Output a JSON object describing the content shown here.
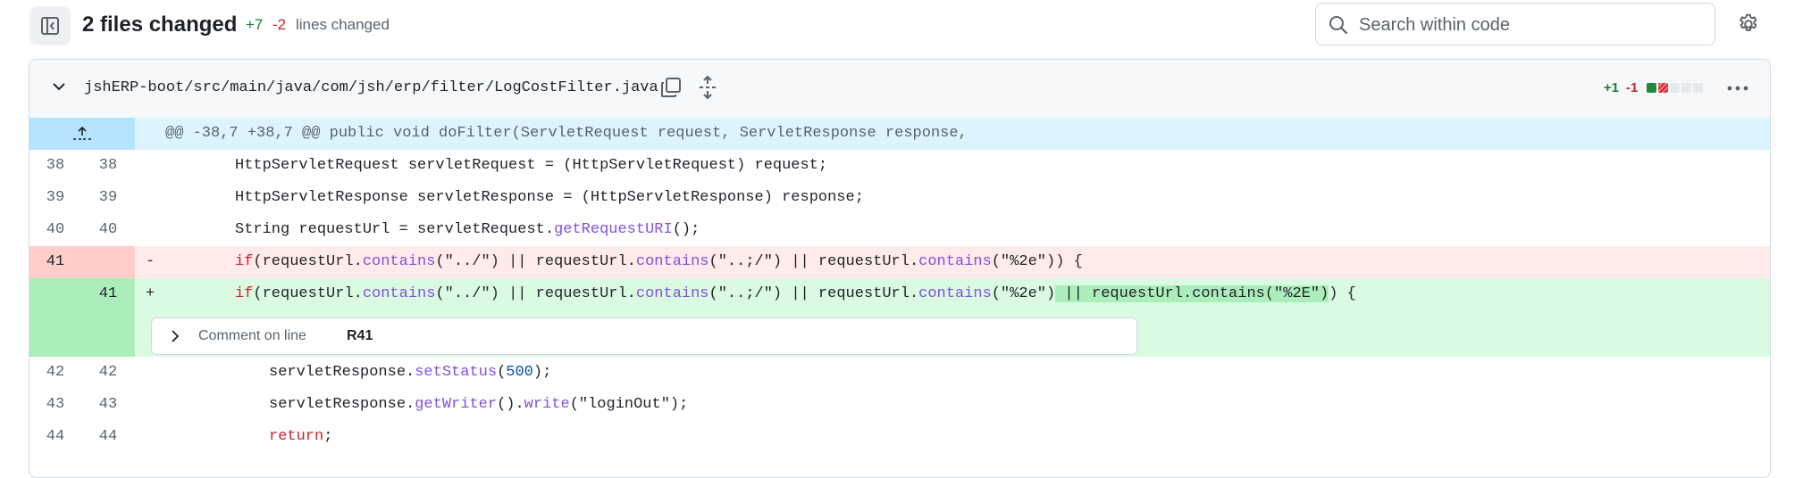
{
  "header": {
    "title": "2 files changed",
    "additions": "+7",
    "deletions": "-2",
    "lines_changed_label": "lines changed",
    "search_placeholder": "Search within code"
  },
  "file": {
    "path": "jshERP-boot/src/main/java/com/jsh/erp/filter/LogCostFilter.java",
    "additions": "+1",
    "deletions": "-1",
    "diffstat_blocks": [
      "added",
      "deleted",
      "neutral",
      "neutral",
      "neutral"
    ]
  },
  "diff": {
    "hunk_header": "@@ -38,7 +38,7 @@ public void doFilter(ServletRequest request, ServletResponse response,",
    "lines": [
      {
        "old": "38",
        "new": "38",
        "type": "context"
      },
      {
        "old": "39",
        "new": "39",
        "type": "context"
      },
      {
        "old": "40",
        "new": "40",
        "type": "context"
      },
      {
        "old": "41",
        "new": "",
        "type": "deleted",
        "sign": "-"
      },
      {
        "old": "",
        "new": "41",
        "type": "added",
        "sign": "+"
      },
      {
        "old": "42",
        "new": "42",
        "type": "context"
      },
      {
        "old": "43",
        "new": "43",
        "type": "context"
      },
      {
        "old": "44",
        "new": "44",
        "type": "context"
      }
    ],
    "comment": {
      "label": "Comment on line",
      "line_ref": "R41"
    }
  },
  "code": {
    "l38": "HttpServletRequest servletRequest = (HttpServletRequest) request;",
    "l39": "HttpServletResponse servletResponse = (HttpServletResponse) response;",
    "l40_a": "String requestUrl = servletRequest.",
    "l40_fn": "getRequestURI",
    "l40_b": "();",
    "if": "if",
    "open_a": "(requestUrl.",
    "contains": "contains",
    "s1": "(\"../\") || requestUrl.",
    "s2": "(\"..;/\") || requestUrl.",
    "s3_old": "(\"%2e\")) {",
    "s3_new": "(\"%2e\")",
    "added_hl": " || requestUrl.contains(\"%2E\")",
    "tail_new": ") {",
    "l42_a": "servletResponse.",
    "l42_fn": "setStatus",
    "l42_b": "(",
    "l42_num": "500",
    "l42_c": ");",
    "l43_a": "servletResponse.",
    "l43_fn1": "getWriter",
    "l43_b": "().",
    "l43_fn2": "write",
    "l43_c": "(\"loginOut\");",
    "l44_kw": "return",
    "l44_b": ";"
  }
}
